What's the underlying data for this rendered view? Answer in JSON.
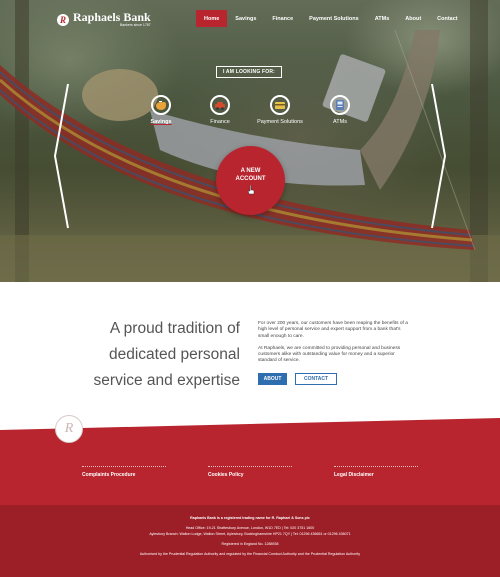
{
  "brand": {
    "name": "Raphaels Bank",
    "tagline": "Bankers since 1787",
    "mark": "R"
  },
  "nav": {
    "items": [
      {
        "label": "Home",
        "active": true
      },
      {
        "label": "Savings",
        "active": false
      },
      {
        "label": "Finance",
        "active": false
      },
      {
        "label": "Payment Solutions",
        "active": false
      },
      {
        "label": "ATMs",
        "active": false
      },
      {
        "label": "About",
        "active": false
      },
      {
        "label": "Contact",
        "active": false
      }
    ]
  },
  "hero": {
    "looking_for": "I AM LOOKING FOR:",
    "categories": [
      {
        "label": "Savings",
        "icon": "piggy-bank-icon",
        "active": true
      },
      {
        "label": "Finance",
        "icon": "car-icon",
        "active": false
      },
      {
        "label": "Payment Solutions",
        "icon": "card-icon",
        "active": false
      },
      {
        "label": "ATMs",
        "icon": "atm-icon",
        "active": false
      }
    ],
    "cta_line1": "A NEW",
    "cta_line2": "ACCOUNT"
  },
  "intro": {
    "heading_line1": "A proud tradition of",
    "heading_line2": "dedicated personal",
    "heading_line3": "service and expertise",
    "paragraph1": "For over 200 years, our customers have been reaping the benefits of a high level of personal service and expert support from a bank that's small enough to care.",
    "paragraph2": "At Raphaels, we are committed to providing personal and business customers alike with outstanding value for money and a superior standard of service.",
    "about_button": "ABOUT",
    "contact_button": "CONTACT"
  },
  "footer": {
    "seal_mark": "R",
    "links": [
      "Complaints Procedure",
      "Cookies Policy",
      "Legal Disclaimer"
    ],
    "legal_line1": "Raphaels Bank is a registered trading name for R. Raphael & Sons plc",
    "legal_line2": "Head Office: 19-21 Shaftesbury Avenue, London, W1D 7ED | Tel: 020 3751 1600",
    "legal_line3": "Aylesbury Branch: Walton Lodge, Walton Street, Aylesbury, Buckinghamshire HP21 7QY | Tel: 01296 436661 or 01296 436071",
    "legal_line4": "Registered in England No. 1288938",
    "legal_line5": "Authorised by the Prudential Regulation Authority and regulated by the Financial Conduct Authority and the Prudential Regulation Authority"
  },
  "colors": {
    "brand_red": "#b8252f",
    "footer_red": "#9c1f28",
    "button_blue": "#2e6db0"
  }
}
